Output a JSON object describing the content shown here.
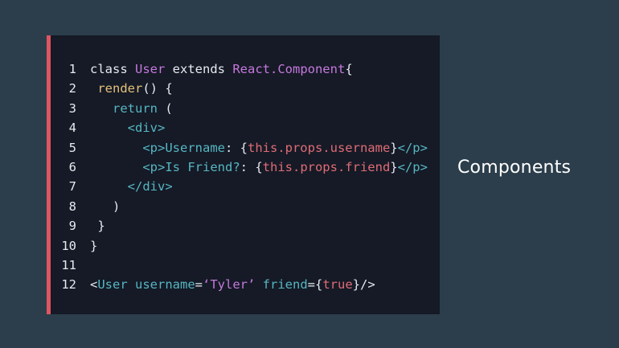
{
  "title": "Components",
  "colors": {
    "background": "#2c3e4b",
    "panel": "#151a26",
    "accent_bar": "#e05561",
    "plain": "#e6e9ef",
    "purple": "#c678dd",
    "yellow": "#e5c07b",
    "cyan": "#56b6c2",
    "red": "#e06c75",
    "blue": "#61afef"
  },
  "code_lines": [
    {
      "num": "1",
      "tokens": [
        {
          "t": "class ",
          "c": "plain"
        },
        {
          "t": "User",
          "c": "purple"
        },
        {
          "t": " extends ",
          "c": "plain"
        },
        {
          "t": "React.Component",
          "c": "purple"
        },
        {
          "t": "{",
          "c": "plain"
        }
      ]
    },
    {
      "num": "2",
      "tokens": [
        {
          "t": " ",
          "c": "plain"
        },
        {
          "t": "render",
          "c": "yellow"
        },
        {
          "t": "() {",
          "c": "plain"
        }
      ]
    },
    {
      "num": "3",
      "tokens": [
        {
          "t": "   ",
          "c": "plain"
        },
        {
          "t": "return",
          "c": "cyan"
        },
        {
          "t": " (",
          "c": "plain"
        }
      ]
    },
    {
      "num": "4",
      "tokens": [
        {
          "t": "     ",
          "c": "plain"
        },
        {
          "t": "<div>",
          "c": "cyan"
        }
      ]
    },
    {
      "num": "5",
      "tokens": [
        {
          "t": "       ",
          "c": "plain"
        },
        {
          "t": "<p>",
          "c": "cyan"
        },
        {
          "t": "Username",
          "c": "cyan"
        },
        {
          "t": ": {",
          "c": "plain"
        },
        {
          "t": "this.props.username",
          "c": "red"
        },
        {
          "t": "}",
          "c": "plain"
        },
        {
          "t": "</p>",
          "c": "cyan"
        }
      ]
    },
    {
      "num": "6",
      "tokens": [
        {
          "t": "       ",
          "c": "plain"
        },
        {
          "t": "<p>",
          "c": "cyan"
        },
        {
          "t": "Is Friend?",
          "c": "cyan"
        },
        {
          "t": ": {",
          "c": "plain"
        },
        {
          "t": "this.props.friend",
          "c": "red"
        },
        {
          "t": "}",
          "c": "plain"
        },
        {
          "t": "</p>",
          "c": "cyan"
        }
      ]
    },
    {
      "num": "7",
      "tokens": [
        {
          "t": "     ",
          "c": "plain"
        },
        {
          "t": "</div>",
          "c": "cyan"
        }
      ]
    },
    {
      "num": "8",
      "tokens": [
        {
          "t": "   )",
          "c": "plain"
        }
      ]
    },
    {
      "num": "9",
      "tokens": [
        {
          "t": " }",
          "c": "plain"
        }
      ]
    },
    {
      "num": "10",
      "tokens": [
        {
          "t": "}",
          "c": "plain"
        }
      ]
    },
    {
      "num": "11",
      "tokens": []
    },
    {
      "num": "12",
      "tokens": [
        {
          "t": "<",
          "c": "plain"
        },
        {
          "t": "User",
          "c": "cyan"
        },
        {
          "t": " username",
          "c": "cyan"
        },
        {
          "t": "=",
          "c": "plain"
        },
        {
          "t": "‘Tyler’",
          "c": "purple"
        },
        {
          "t": " friend",
          "c": "cyan"
        },
        {
          "t": "={",
          "c": "plain"
        },
        {
          "t": "true",
          "c": "red"
        },
        {
          "t": "}/>",
          "c": "plain"
        }
      ]
    }
  ]
}
